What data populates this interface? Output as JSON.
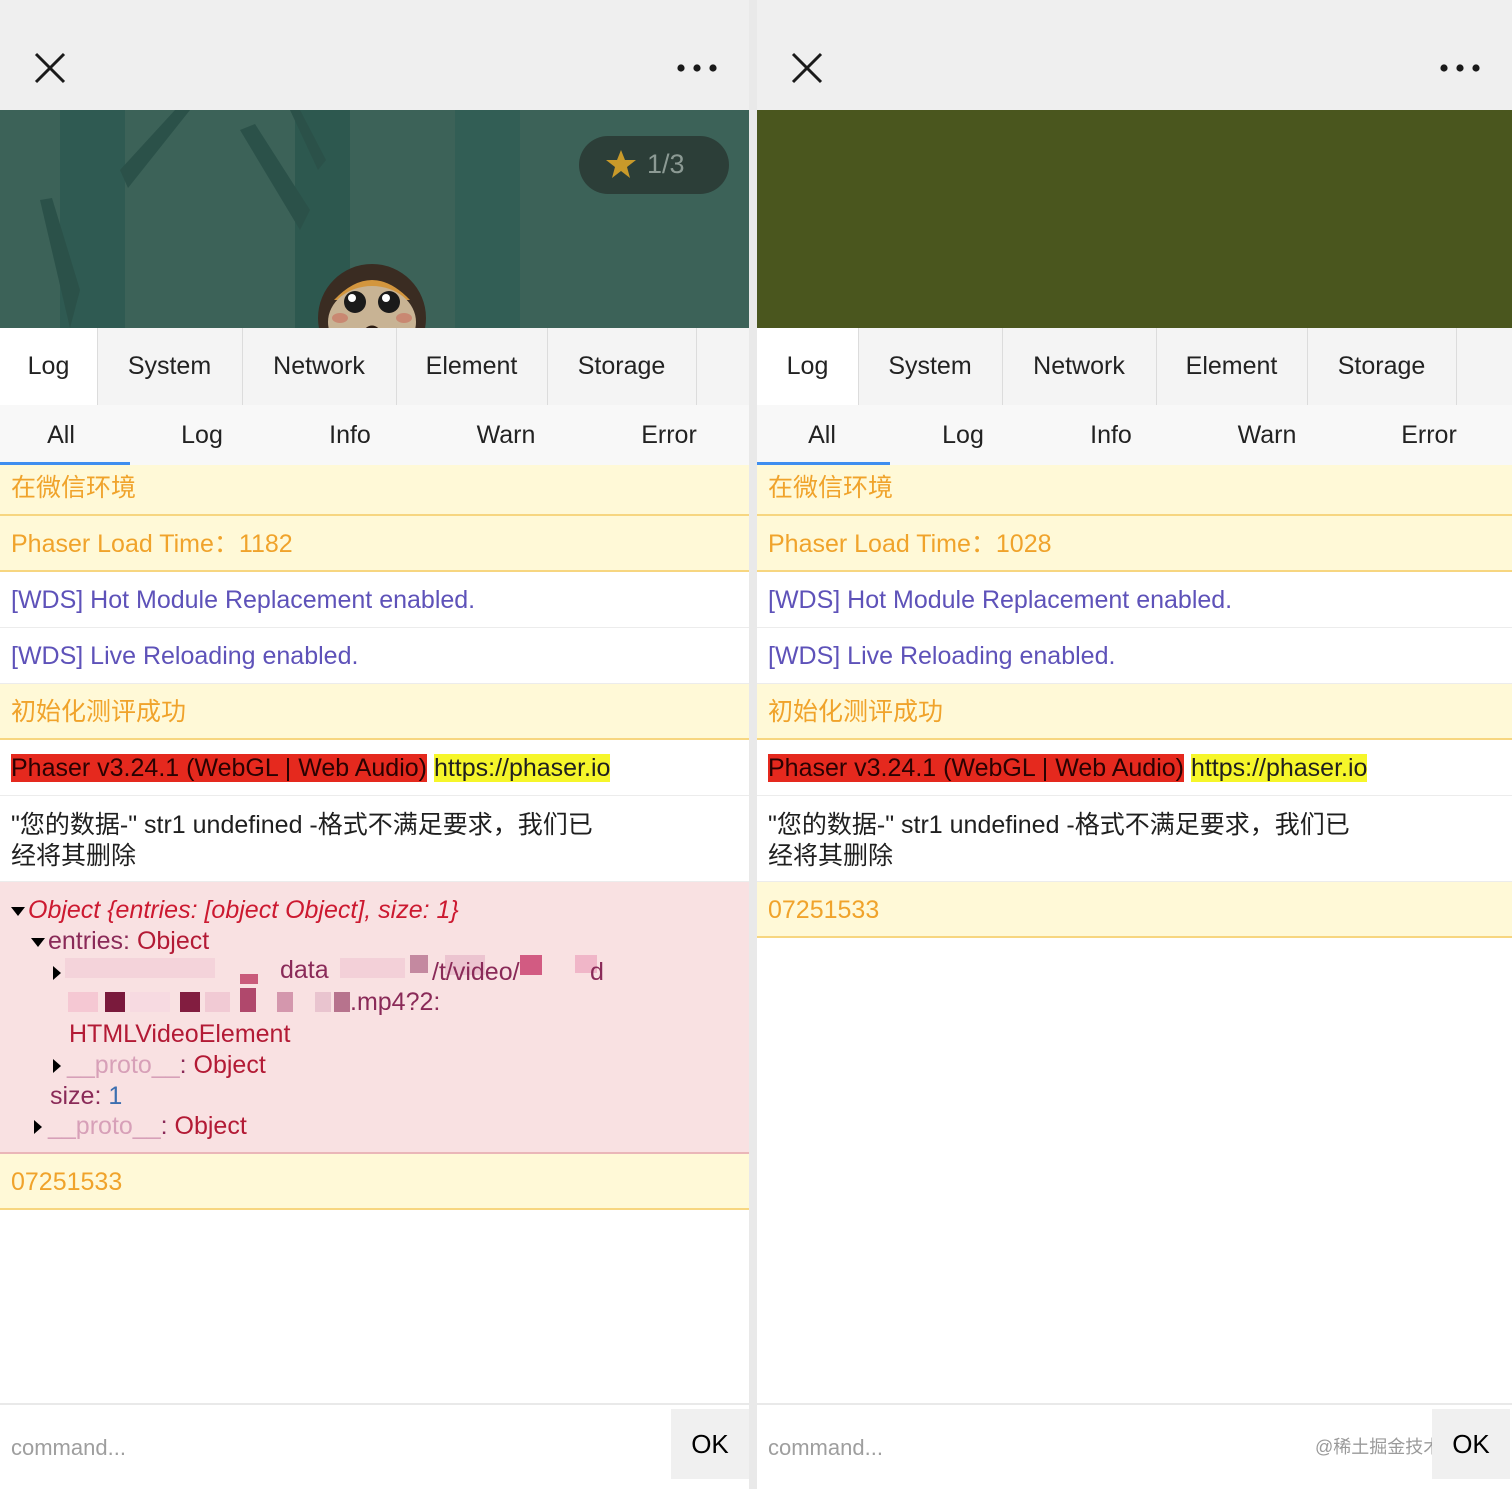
{
  "tabs": [
    "Log",
    "System",
    "Network",
    "Element",
    "Storage"
  ],
  "subtabs": [
    "All",
    "Log",
    "Info",
    "Warn",
    "Error"
  ],
  "colors": {
    "warn_text": "#f0a32b",
    "warn_bg": "#fff9d7",
    "info_text": "#5e52b9",
    "error_bg": "#f9e1e2",
    "phaser_red": "#e5291e",
    "phaser_yellow": "#f6f62a",
    "tab_underline": "#3f8ef0",
    "game_left_bg": "#3c6258",
    "game_right_bg": "#4a561e"
  },
  "left": {
    "game": {
      "star_count": "1/3"
    },
    "logs": {
      "wechat_env": "在微信环境",
      "phaser_load_time": "Phaser Load Time：1182",
      "hmr": "[WDS] Hot Module Replacement enabled.",
      "live_reload": "[WDS] Live Reloading enabled.",
      "init_success": "初始化测评成功",
      "phaser_version": "Phaser v3.24.1 (WebGL | Web Audio)",
      "phaser_url": "https://phaser.io",
      "data_msg_line1": "\"您的数据-\" str1 undefined -格式不满足要求，我们已",
      "data_msg_line2": "经将其删除",
      "object_header": "Object {entries: [object Object], size: 1}",
      "entries_key": "entries",
      "entries_val": "Object",
      "entry_partial_1": "data",
      "entry_partial_2": "/t/video/",
      "entry_partial_3": "d",
      "entry_mp4": ".mp4?2:",
      "entry_value": "HTMLVideoElement",
      "proto_key": "__proto__",
      "proto_val": "Object",
      "size_key": "size",
      "size_val": "1",
      "number": "07251533"
    },
    "command": {
      "placeholder": "command...",
      "ok": "OK"
    }
  },
  "right": {
    "logs": {
      "wechat_env": "在微信环境",
      "phaser_load_time": "Phaser Load Time：1028",
      "hmr": "[WDS] Hot Module Replacement enabled.",
      "live_reload": "[WDS] Live Reloading enabled.",
      "init_success": "初始化测评成功",
      "phaser_version": "Phaser v3.24.1 (WebGL | Web Audio)",
      "phaser_url": "https://phaser.io",
      "data_msg_line1": "\"您的数据-\" str1 undefined -格式不满足要求，我们已",
      "data_msg_line2": "经将其删除",
      "number": "07251533"
    },
    "command": {
      "placeholder": "command...",
      "ok": "OK"
    },
    "watermark": "@稀土掘金技术社区"
  }
}
